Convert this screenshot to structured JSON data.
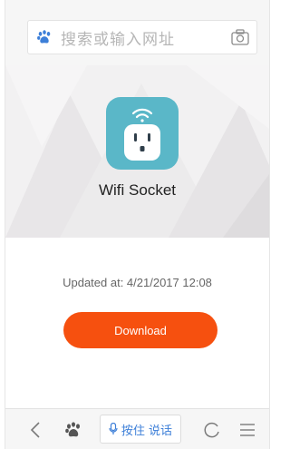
{
  "search": {
    "placeholder": "搜索或输入网址"
  },
  "app": {
    "name": "Wifi Socket"
  },
  "updated": {
    "text": "Updated at: 4/21/2017 12:08"
  },
  "download": {
    "label": "Download"
  },
  "toolbar": {
    "voice_label": "按住 说话"
  },
  "colors": {
    "accent": "#f6500f",
    "icon_bg": "#5ab7c8",
    "voice": "#3d7fd8"
  }
}
